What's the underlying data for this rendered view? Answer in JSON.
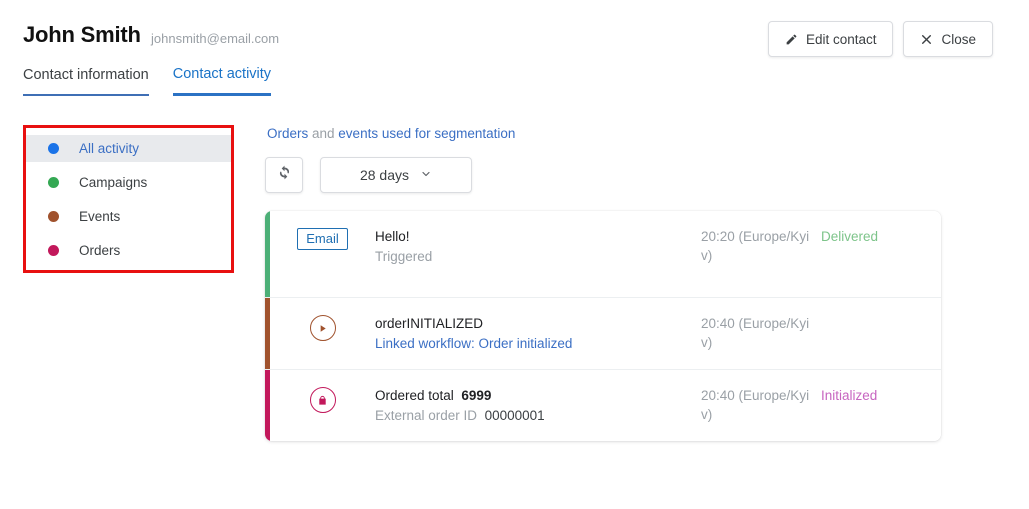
{
  "header": {
    "contact_name": "John Smith",
    "contact_email": "johnsmith@email.com",
    "edit_button": "Edit contact",
    "close_button": "Close"
  },
  "tabs": [
    {
      "label": "Contact information",
      "active": false
    },
    {
      "label": "Contact activity",
      "active": true
    }
  ],
  "sidebar": {
    "highlight_color": "#e81010",
    "items": [
      {
        "label": "All activity",
        "color": "#1a73e8",
        "active": true
      },
      {
        "label": "Campaigns",
        "color": "#34a853",
        "active": false
      },
      {
        "label": "Events",
        "color": "#a0522d",
        "active": false
      },
      {
        "label": "Orders",
        "color": "#c2185b",
        "active": false
      }
    ]
  },
  "main": {
    "segmentation_note": {
      "link1": "Orders",
      "middle": " and ",
      "link2": "events used for segmentation"
    },
    "toolbar": {
      "refresh_icon": "refresh-icon",
      "period_label": "28 days",
      "chevron_icon": "chevron-down-icon"
    },
    "activity_rows": [
      {
        "bar_color": "#4caf77",
        "badge": "Email",
        "icon": "email-badge",
        "title": "Hello!",
        "subtitle": "Triggered",
        "subtitle_style": "muted",
        "time": "20:20 (Europe/Kyiv)",
        "status": "Delivered",
        "status_color": "#7dc48a"
      },
      {
        "bar_color": "#a0522d",
        "icon": "play-circle-icon",
        "icon_color": "#a0522d",
        "title": "orderINITIALIZED",
        "subtitle": "Linked workflow: Order initialized",
        "subtitle_style": "link",
        "time": "20:40 (Europe/Kyiv)",
        "status": "",
        "status_color": ""
      },
      {
        "bar_color": "#c2185b",
        "icon": "order-bag-icon",
        "icon_color": "#c2185b",
        "title_label": "Ordered total",
        "title_value": "6999",
        "subtitle_label": "External order ID",
        "subtitle_value": "00000001",
        "time": "20:40 (Europe/Kyiv)",
        "status": "Initialized",
        "status_color": "#c765c0"
      }
    ]
  }
}
